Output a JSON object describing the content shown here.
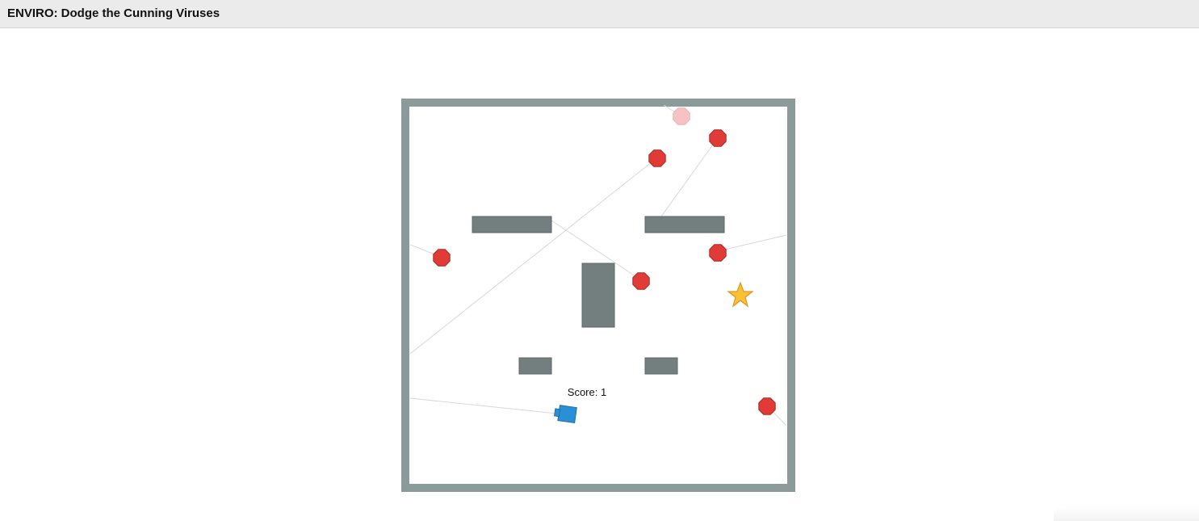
{
  "window": {
    "title": "ENVIRO: Dodge the Cunning Viruses"
  },
  "game": {
    "score_text": "Score: 1",
    "entities": {
      "player": {
        "type": "blue-square-agent",
        "color": "#2b8fd6"
      },
      "goal": {
        "type": "star",
        "color": "#f7c236"
      },
      "enemies": {
        "type": "red-octagon-virus",
        "color": "#e03b36",
        "count": 7
      },
      "faded_enemy": {
        "type": "red-octagon-virus",
        "color": "#f5c4c2"
      },
      "walls": {
        "color": "#737f7e"
      },
      "border": {
        "color": "#8a9b99"
      }
    }
  }
}
